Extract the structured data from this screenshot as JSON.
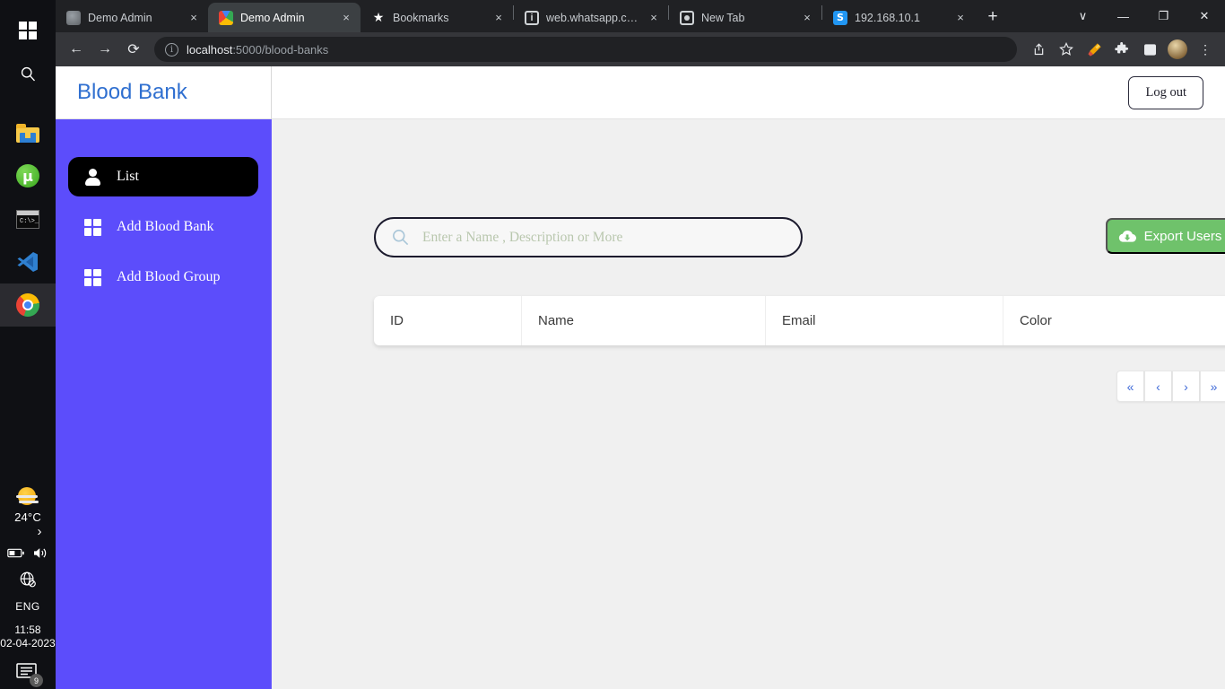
{
  "taskbar": {
    "start_label": "start-button",
    "search_label": "taskbar-search",
    "apps": [
      {
        "name": "file-explorer",
        "label": "File Explorer"
      },
      {
        "name": "utorrent",
        "label": "uTorrent",
        "glyph": "µ"
      },
      {
        "name": "command-prompt",
        "label": "Command Prompt",
        "glyph": "C:\\>_"
      },
      {
        "name": "vs-code",
        "label": "Visual Studio Code"
      },
      {
        "name": "google-chrome",
        "label": "Google Chrome"
      }
    ],
    "tray": {
      "temperature": "24°C",
      "chevron": "›",
      "language": "ENG",
      "time": "11:58",
      "date": "02-04-2023",
      "notification_count": "9"
    }
  },
  "browser": {
    "tabs": [
      {
        "title": "Demo Admin",
        "favicon": "globe-icon",
        "active": false,
        "close": "×"
      },
      {
        "title": "Demo Admin",
        "favicon": "demo-admin-icon",
        "active": true,
        "close": "×"
      },
      {
        "title": "Bookmarks",
        "favicon": "star-icon",
        "active": false,
        "close": "×"
      },
      {
        "title": "web.whatsapp.com",
        "favicon": "info-icon",
        "active": false,
        "close": "×"
      },
      {
        "title": "New Tab",
        "favicon": "chrome-icon",
        "active": false,
        "close": "×"
      },
      {
        "title": "192.168.10.1",
        "favicon": "s-icon",
        "active": false,
        "close": "×"
      }
    ],
    "new_tab_label": "+",
    "window_controls": {
      "tab_search": "∨",
      "minimize": "—",
      "maximize": "❐",
      "close": "✕"
    },
    "nav": {
      "back": "←",
      "forward": "→",
      "reload": "⟳"
    },
    "omnibox": {
      "info_icon": "ⓘ",
      "host": "localhost",
      "path": ":5000/blood-banks"
    },
    "toolbar_icons": [
      {
        "name": "share-icon",
        "glyph": "↗"
      },
      {
        "name": "bookmark-star-icon",
        "glyph": "☆"
      },
      {
        "name": "highlighter-pen-icon",
        "glyph": "✎"
      },
      {
        "name": "extensions-puzzle-icon",
        "glyph": "❖"
      },
      {
        "name": "side-panel-icon",
        "glyph": "▣"
      },
      {
        "name": "profile-avatar",
        "glyph": ""
      },
      {
        "name": "chrome-menu-icon",
        "glyph": "⋮"
      }
    ]
  },
  "app": {
    "brand": "Blood Bank",
    "logout_label": "Log out",
    "sidebar": [
      {
        "label": "List",
        "icon": "person-icon",
        "active": true
      },
      {
        "label": "Add Blood Bank",
        "icon": "grid-icon",
        "active": false
      },
      {
        "label": "Add Blood Group",
        "icon": "grid-icon",
        "active": false
      }
    ],
    "search": {
      "placeholder": "Enter a Name , Description or More",
      "value": "",
      "icon": "search-icon"
    },
    "export_button": {
      "label": "Export Users",
      "icon": "cloud-download-icon",
      "color": "#6fc26b"
    },
    "table": {
      "columns": [
        "ID",
        "Name",
        "Email",
        "Color"
      ],
      "rows": []
    },
    "pagination": [
      {
        "name": "first-page-button",
        "glyph": "«"
      },
      {
        "name": "previous-page-button",
        "glyph": "‹"
      },
      {
        "name": "next-page-button",
        "glyph": "›"
      },
      {
        "name": "last-page-button",
        "glyph": "»"
      }
    ],
    "colors": {
      "sidebar": "#5c4dfb",
      "brand_text": "#2f6fd0",
      "active_item": "#000000",
      "export_green": "#6fc26b",
      "pagination_blue": "#3f6ad8"
    }
  }
}
